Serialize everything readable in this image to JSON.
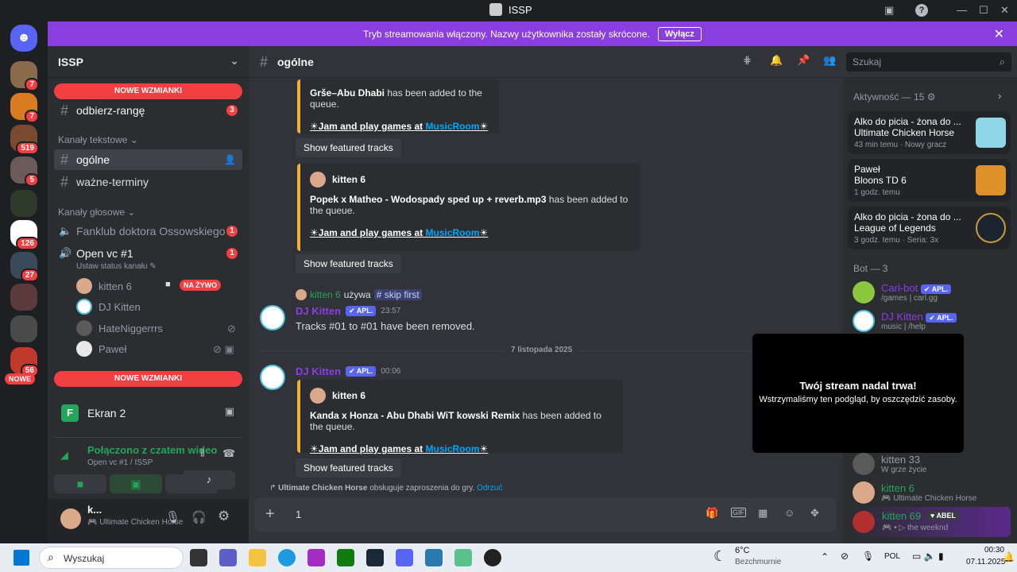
{
  "window": {
    "title": "ISSP"
  },
  "banner": {
    "text": "Tryb streamowania włączony. Nazwy użytkownika zostały skrócone.",
    "button": "Wyłącz"
  },
  "rail": {
    "badges": [
      "7",
      "7",
      "519",
      "5",
      "126",
      "27",
      "56"
    ],
    "new_label": "NOWE"
  },
  "server": {
    "name": "ISSP"
  },
  "sidebar": {
    "new_mentions": "NOWE WZMIANKI",
    "channel_odbierz": "odbierz-rangę",
    "odbierz_count": "3",
    "cat_text": "Kanały tekstowe",
    "channel_ogolne": "ogólne",
    "channel_wazne": "ważne-terminy",
    "cat_voice": "Kanały głosowe",
    "vc_fanklub": "Fanklub doktora Ossowskiego",
    "fanklub_count": "1",
    "vc_open": "Open vc #1",
    "open_count": "1",
    "vc_status": "Ustaw status kanału",
    "users": [
      "kitten 6",
      "DJ Kitten",
      "HateNiggerrrs",
      "Paweł"
    ],
    "live": "NA ŻYWO"
  },
  "stream": {
    "label": "Ekran 2"
  },
  "voice": {
    "status": "Połączono z czatem wideo",
    "channel": "Open vc #1 / ISSP"
  },
  "user": {
    "name": "k...",
    "activity": "Ultimate Chicken Horse"
  },
  "main": {
    "channel": "ogólne",
    "search_placeholder": "Szukaj",
    "m1_song": "Grše–Abu Dhabi",
    "added": "has been added to the queue.",
    "jam": "Jam and play games at ",
    "musicroom": "MusicRoom",
    "featured": "Show featured tracks",
    "m2_user": "kitten 6",
    "m2_song": "Popek x Matheo - Wodospady sped up + reverb.mp3",
    "used_user": "kitten 6",
    "used": "używa",
    "skip": "skip first",
    "bot_name": "DJ Kitten",
    "apl": "APL.",
    "t1": "23:57",
    "removed": "Tracks #01 to #01 have been removed.",
    "date": "7 listopada 2025",
    "t2": "00:06",
    "m3_user": "kitten 6",
    "m3_song": "Kanda x Honza - Abu Dhabi WiT kowski Remix",
    "invite_game": "Ultimate Chicken Horse",
    "invite_text": "obsługuje zaproszenia do gry.",
    "invite_dismiss": "Odrzuć",
    "input_value": "1"
  },
  "members": {
    "activity_header": "Aktywność — 15",
    "acts": [
      {
        "title": "Alko do picia - żona do ...",
        "game": "Ultimate Chicken Horse",
        "time": "43 min temu",
        "extra": "Nowy gracz"
      },
      {
        "title": "Paweł",
        "game": "Bloons TD 6",
        "time": "1 godz. temu",
        "extra": ""
      },
      {
        "title": "Alko do picia - żona do ...",
        "game": "League of Legends",
        "time": "3 godz. temu",
        "extra": "Seria: 3x"
      }
    ],
    "bot_header": "Bot — 3",
    "bots": [
      {
        "name": "Carl-bot",
        "status": "/games | carl.gg"
      },
      {
        "name": "DJ Kitten",
        "status": "music | /help"
      }
    ],
    "users": [
      {
        "name": "kitten 33",
        "status": "W grze życie"
      },
      {
        "name": "kitten 6",
        "status": "Ultimate Chicken Horse"
      },
      {
        "name": "kitten 69",
        "status": "the weeknd",
        "tag": "ABEL"
      }
    ]
  },
  "overlay": {
    "title": "Twój stream nadal trwa!",
    "text": "Wstrzymaliśmy ten podgląd, by oszczędzić zasoby."
  },
  "taskbar": {
    "search": "Wyszukaj",
    "temp": "6°C",
    "weather": "Bezchmurnie",
    "lang": "POL",
    "time": "00:30",
    "date": "07.11.2025"
  }
}
